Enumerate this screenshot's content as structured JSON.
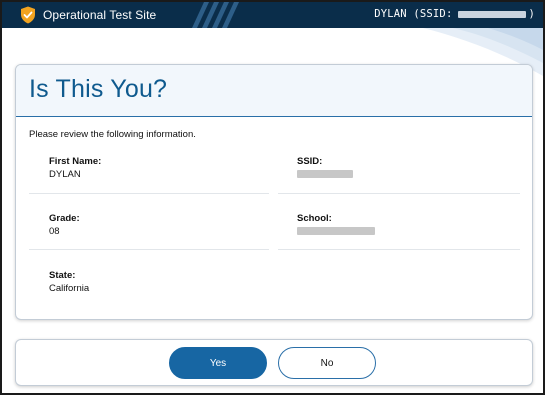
{
  "header": {
    "site_title": "Operational Test Site",
    "user_label": "DYLAN (SSID:",
    "user_label_suffix": ")",
    "logo_icon": "shield-check-icon",
    "colors": {
      "bar": "#0a2d4a",
      "logo": "#f2a320"
    }
  },
  "card": {
    "title": "Is This You?",
    "review_text": "Please review the following information.",
    "fields": {
      "first_name": {
        "label": "First Name:",
        "value": "DYLAN"
      },
      "ssid": {
        "label": "SSID:",
        "value": ""
      },
      "grade": {
        "label": "Grade:",
        "value": "08"
      },
      "school": {
        "label": "School:",
        "value": ""
      },
      "state": {
        "label": "State:",
        "value": "California"
      }
    }
  },
  "actions": {
    "yes_label": "Yes",
    "no_label": "No",
    "colors": {
      "primary": "#1766a3"
    }
  }
}
